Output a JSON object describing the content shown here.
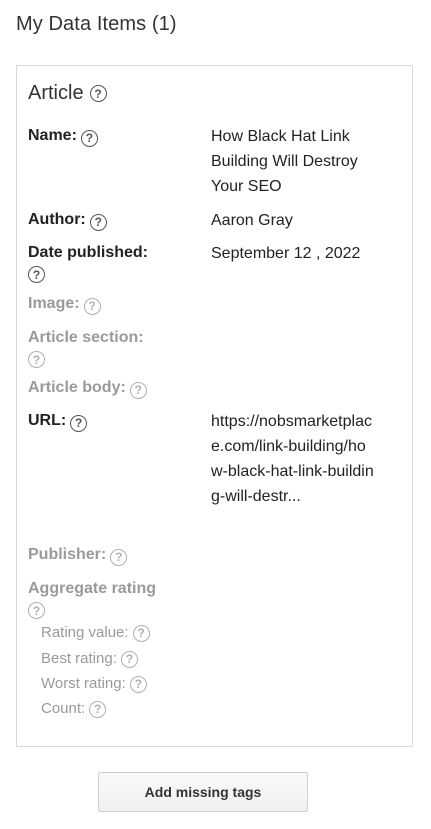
{
  "header": {
    "title": "My Data Items (1)"
  },
  "item": {
    "type": "Article",
    "fields": {
      "name": {
        "label": "Name:",
        "value": "How Black Hat Link Building Will Destroy Your SEO"
      },
      "author": {
        "label": "Author:",
        "value": "Aaron Gray"
      },
      "date_published": {
        "label": "Date published:",
        "value": "September 12 , 2022"
      },
      "image": {
        "label": "Image:"
      },
      "article_section": {
        "label": "Article section:"
      },
      "article_body": {
        "label": "Article body:"
      },
      "url": {
        "label": "URL:",
        "value": "https://nobsmarketplace.com/link-building/how-black-hat-link-building-will-destr..."
      },
      "publisher": {
        "label": "Publisher:"
      },
      "aggregate_rating": {
        "label": "Aggregate rating",
        "rating_value": "Rating value:",
        "best_rating": "Best rating:",
        "worst_rating": "Worst rating:",
        "count": "Count:"
      }
    }
  },
  "actions": {
    "add_missing_tags": "Add missing tags"
  },
  "help_glyph": "?"
}
